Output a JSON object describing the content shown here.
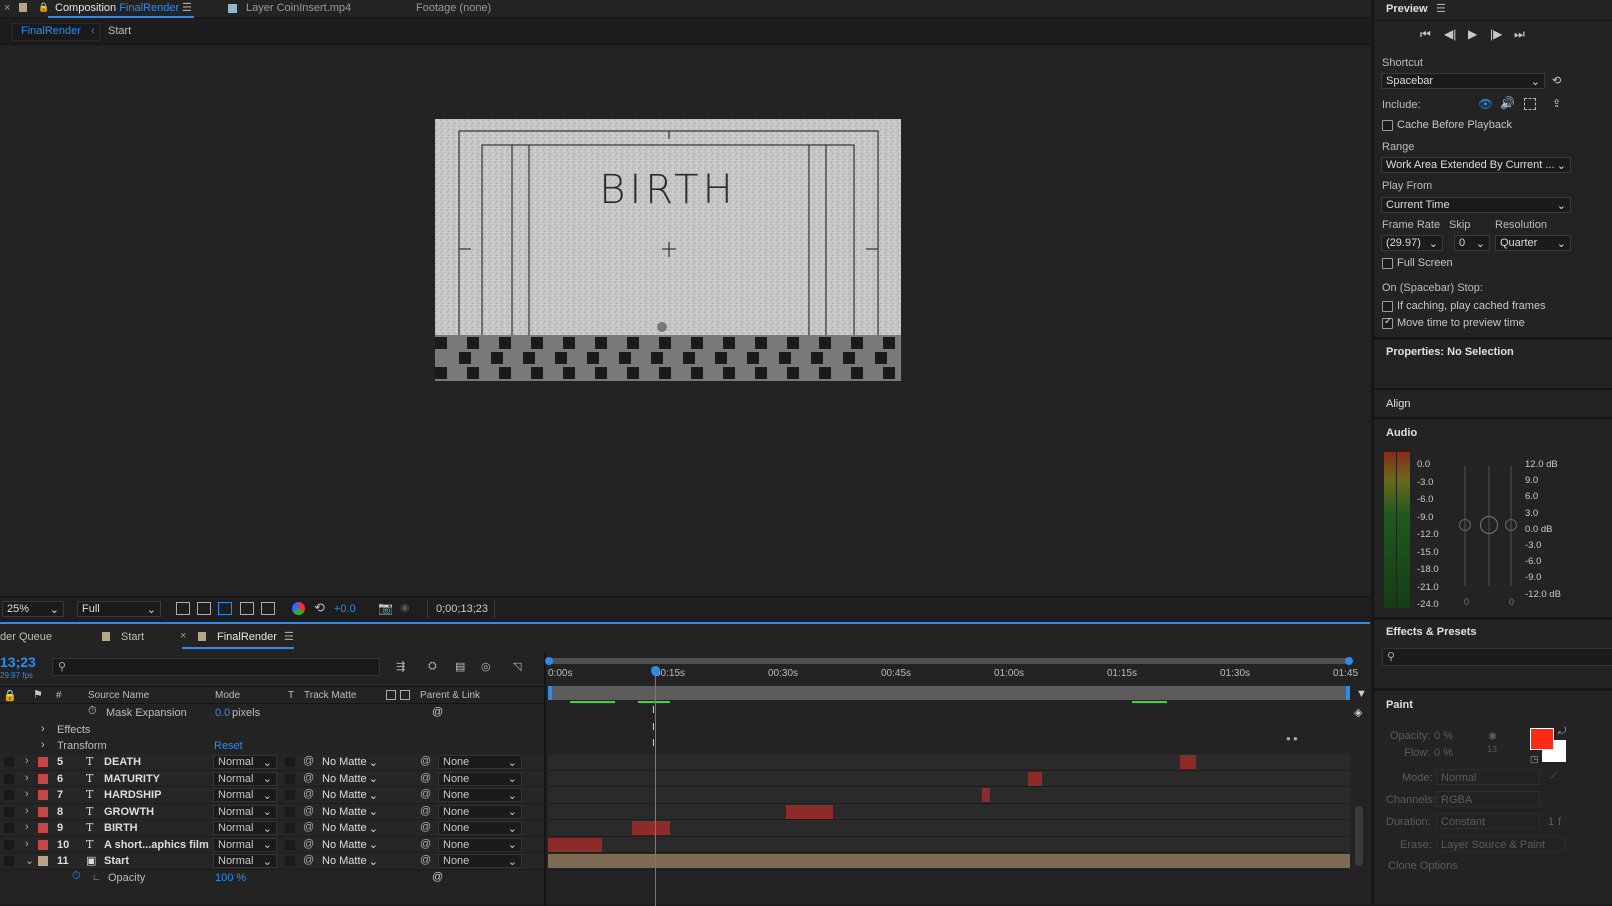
{
  "top_tabs": {
    "comp_prefix": "Composition",
    "comp_name": "FinalRender",
    "layer_tab": "Layer CoinInsert.mp4",
    "footage_tab": "Footage (none)"
  },
  "breadcrumbs": [
    "FinalRender",
    "Start"
  ],
  "viewer": {
    "comp_text": "BIRTH",
    "zoom": "25%",
    "resolution": "Full",
    "exposure": "+0.0",
    "timecode": "0;00;13;23"
  },
  "timeline_tabs": {
    "render_queue": "der Queue",
    "start": "Start",
    "final": "FinalRender"
  },
  "timeline": {
    "current_time": "13;23",
    "fps": "29.97 fps",
    "columns": {
      "num": "#",
      "source": "Source Name",
      "mode": "Mode",
      "t": "T",
      "matte": "Track Matte",
      "parent": "Parent & Link"
    },
    "ruler": [
      "0:00s",
      "00:15s",
      "00:30s",
      "00:45s",
      "01:00s",
      "01:15s",
      "01:30s",
      "01:45"
    ],
    "props": {
      "mask_expansion": "Mask Expansion",
      "mask_value": "0.0",
      "mask_unit": "pixels",
      "effects": "Effects",
      "transform": "Transform",
      "reset": "Reset",
      "opacity": "Opacity",
      "opacity_value": "100 %"
    },
    "layers": [
      {
        "num": "5",
        "name": "DEATH",
        "mode": "Normal",
        "matte": "No Matte",
        "parent": "None"
      },
      {
        "num": "6",
        "name": "MATURITY",
        "mode": "Normal",
        "matte": "No Matte",
        "parent": "None"
      },
      {
        "num": "7",
        "name": "HARDSHIP",
        "mode": "Normal",
        "matte": "No Matte",
        "parent": "None"
      },
      {
        "num": "8",
        "name": "GROWTH",
        "mode": "Normal",
        "matte": "No Matte",
        "parent": "None"
      },
      {
        "num": "9",
        "name": "BIRTH",
        "mode": "Normal",
        "matte": "No Matte",
        "parent": "None"
      },
      {
        "num": "10",
        "name": "A short...aphics film",
        "mode": "Normal",
        "matte": "No Matte",
        "parent": "None"
      },
      {
        "num": "11",
        "name": "Start",
        "mode": "Normal",
        "matte": "No Matte",
        "parent": "None"
      }
    ]
  },
  "preview": {
    "title": "Preview",
    "shortcut_label": "Shortcut",
    "shortcut_value": "Spacebar",
    "include_label": "Include:",
    "cache_label": "Cache Before Playback",
    "range_label": "Range",
    "range_value": "Work Area Extended By Current ...",
    "play_from_label": "Play From",
    "play_from_value": "Current Time",
    "frame_rate_label": "Frame Rate",
    "skip_label": "Skip",
    "resolution_label": "Resolution",
    "frame_rate_value": "(29.97)",
    "skip_value": "0",
    "resolution_value": "Quarter",
    "full_screen_label": "Full Screen",
    "on_stop_label": "On (Spacebar) Stop:",
    "if_caching_label": "If caching, play cached frames",
    "move_time_label": "Move time to preview time"
  },
  "properties": {
    "title": "Properties: No Selection"
  },
  "align": {
    "title": "Align"
  },
  "audio": {
    "title": "Audio",
    "left_scale": [
      "0.0",
      "-3.0",
      "-6.0",
      "-9.0",
      "-12.0",
      "-15.0",
      "-18.0",
      "-21.0",
      "-24.0"
    ],
    "right_scale": [
      "12.0 dB",
      "9.0",
      "6.0",
      "3.0",
      "0.0 dB",
      "-3.0",
      "-6.0",
      "-9.0",
      "-12.0 dB"
    ],
    "slider_left": "0",
    "slider_right": "0"
  },
  "effects_presets": {
    "title": "Effects & Presets"
  },
  "paint": {
    "title": "Paint",
    "opacity_label": "Opacity:",
    "opacity_value": "0 %",
    "flow_label": "Flow:",
    "flow_value": "0 %",
    "brush_size": "13",
    "mode_label": "Mode:",
    "mode_value": "Normal",
    "channels_label": "Channels:",
    "channels_value": "RGBA",
    "duration_label": "Duration:",
    "duration_value": "Constant",
    "duration_num": "1",
    "duration_unit": "f",
    "erase_label": "Erase:",
    "erase_value": "Layer Source & Paint",
    "clone_options": "Clone Options",
    "fg_color": "#ff2a16",
    "bg_color": "#ffffff"
  },
  "colors": {
    "accent": "#2d8ceb",
    "layer_label": "#c84646",
    "bar": "#8d2b2b",
    "start_bar": "#7d6b54"
  }
}
